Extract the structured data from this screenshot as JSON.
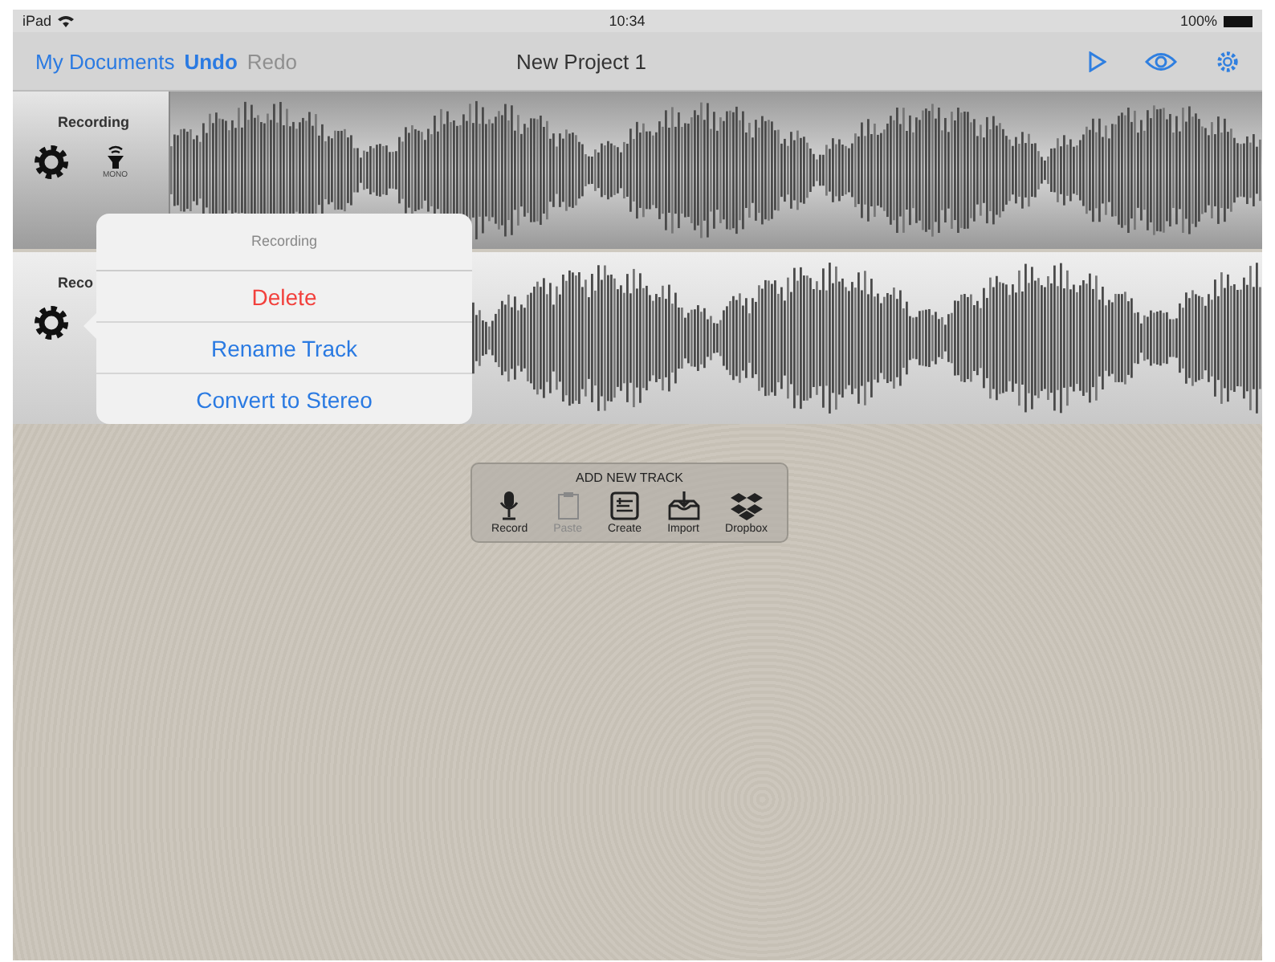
{
  "status_bar": {
    "device": "iPad",
    "time": "10:34",
    "battery": "100%"
  },
  "nav": {
    "back": "My Documents",
    "undo": {
      "label": "Undo",
      "disabled": false
    },
    "redo": {
      "label": "Redo",
      "disabled": true
    },
    "title": "New Project 1"
  },
  "tracks": [
    {
      "name": "Recording",
      "mode": "MONO"
    },
    {
      "name": "Reco"
    }
  ],
  "popover": {
    "title": "Recording",
    "items": [
      {
        "label": "Delete",
        "kind": "destructive"
      },
      {
        "label": "Rename Track",
        "kind": "normal"
      },
      {
        "label": "Convert to Stereo",
        "kind": "normal"
      }
    ]
  },
  "add_track": {
    "title": "ADD NEW TRACK",
    "items": [
      {
        "label": "Record",
        "kind": "record",
        "disabled": false
      },
      {
        "label": "Paste",
        "kind": "paste",
        "disabled": true
      },
      {
        "label": "Create",
        "kind": "create",
        "disabled": false
      },
      {
        "label": "Import",
        "kind": "import",
        "disabled": false
      },
      {
        "label": "Dropbox",
        "kind": "dropbox",
        "disabled": false
      }
    ]
  }
}
